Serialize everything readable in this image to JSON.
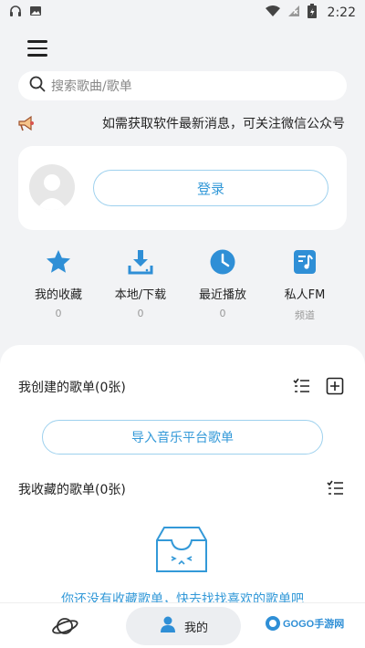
{
  "status_bar": {
    "time": "2:22"
  },
  "search": {
    "placeholder": "搜索歌曲/歌单"
  },
  "notice": {
    "text": "如需获取软件最新消息，可关注微信公众号"
  },
  "login": {
    "button_label": "登录"
  },
  "shortcuts": [
    {
      "label": "我的收藏",
      "sub": "0",
      "icon": "star-icon"
    },
    {
      "label": "本地/下载",
      "sub": "0",
      "icon": "download-icon"
    },
    {
      "label": "最近播放",
      "sub": "0",
      "icon": "clock-icon"
    },
    {
      "label": "私人FM",
      "sub": "频道",
      "icon": "music-note-icon"
    }
  ],
  "created_playlists": {
    "title": "我创建的歌单(0张)"
  },
  "import_button": {
    "label": "导入音乐平台歌单"
  },
  "collected_playlists": {
    "title": "我收藏的歌单(0张)"
  },
  "empty_state": {
    "text": "你还没有收藏歌单，快去找找喜欢的歌单吧"
  },
  "bottom_nav": {
    "mine_label": "我的"
  },
  "watermark": {
    "text": "GOGO手游网"
  },
  "colors": {
    "accent": "#3399d8",
    "accent_border": "#9ed1ee",
    "background": "#f2f3f5"
  }
}
